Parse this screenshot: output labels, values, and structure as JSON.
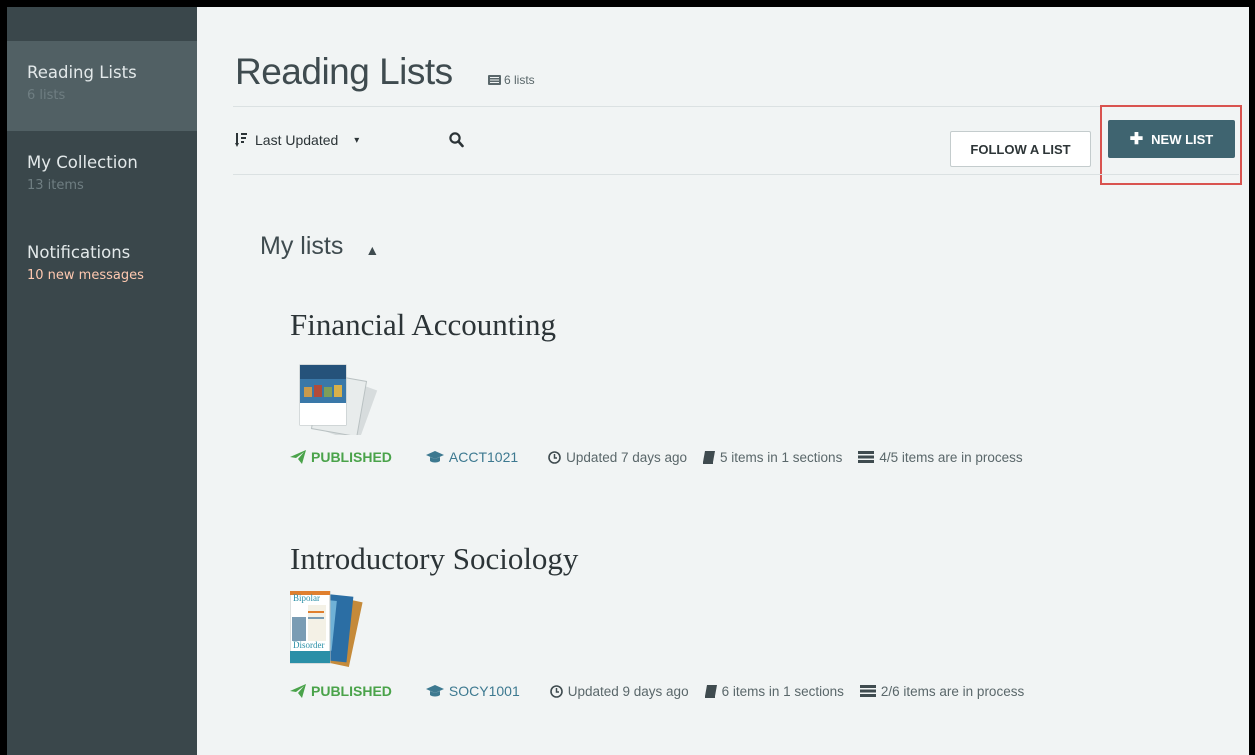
{
  "sidebar": {
    "items": [
      {
        "label": "Reading Lists",
        "sub": "6 lists"
      },
      {
        "label": "My Collection",
        "sub": "13 items"
      },
      {
        "label": "Notifications",
        "sub": "10 new messages"
      }
    ]
  },
  "header": {
    "title": "Reading Lists",
    "count": "6 lists",
    "sort_label": "Last Updated",
    "follow_label": "FOLLOW A LIST",
    "new_label": "NEW LIST"
  },
  "section": {
    "title": "My lists"
  },
  "lists": [
    {
      "title": "Financial Accounting",
      "status": "PUBLISHED",
      "course": "ACCT1021",
      "updated": "Updated 7 days ago",
      "items": "5 items in 1 sections",
      "process": "4/5 items are in process"
    },
    {
      "title": "Introductory Sociology",
      "status": "PUBLISHED",
      "course": "SOCY1001",
      "updated": "Updated 9 days ago",
      "items": "6 items in 1 sections",
      "process": "2/6 items are in process"
    }
  ],
  "colors": {
    "sidebar_bg": "#3a474b",
    "accent": "#3f6470",
    "published": "#4aa34a",
    "course": "#3d7990",
    "highlight": "#d9534f"
  }
}
